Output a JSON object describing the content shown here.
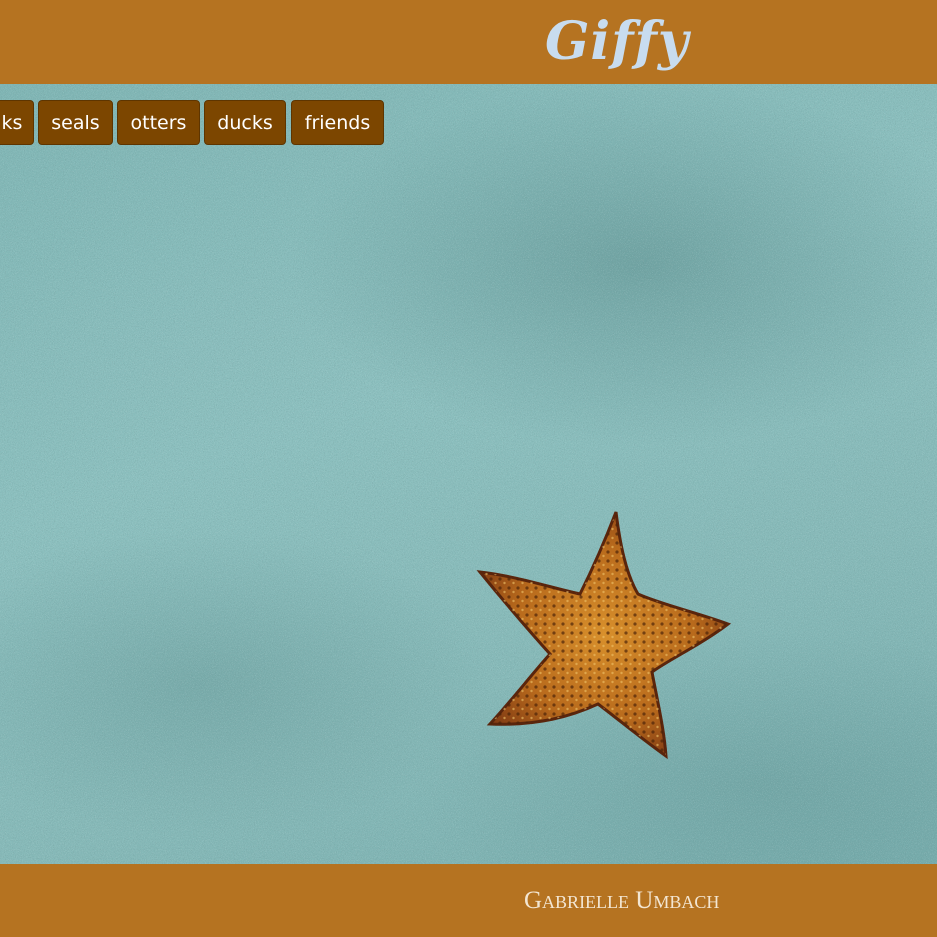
{
  "header": {
    "logo": "Giffy"
  },
  "topics": [
    {
      "label": "ks"
    },
    {
      "label": "seals"
    },
    {
      "label": "otters"
    },
    {
      "label": "ducks"
    },
    {
      "label": "friends"
    }
  ],
  "background": {
    "image": "starfish-on-sand"
  },
  "footer": {
    "author": "Gabrielle Umbach"
  },
  "colors": {
    "header_bg": "#b57321",
    "logo_text": "#c8dcef",
    "button_bg": "#7c4600",
    "button_text": "#ffffff",
    "footer_bg": "#b57321",
    "footer_text": "#f3e6d2"
  }
}
